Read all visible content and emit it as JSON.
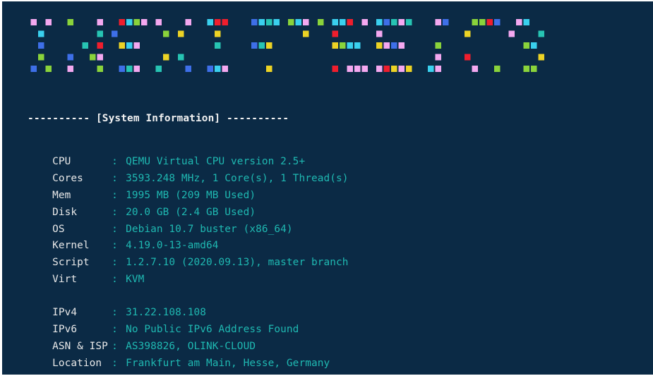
{
  "theme": {
    "background": "#0b2a45",
    "text": "#e8e8e8",
    "value_color": "#1fb9b2",
    "logo_colors": [
      "#3ad0ee",
      "#8ad33b",
      "#ef1e2d",
      "#f4a8f0",
      "#3e6fe8",
      "#ecd325",
      "#27c4b3"
    ]
  },
  "logo": {
    "text": "INSXISTEEIC8",
    "icon": "ascii-art-logo-icon"
  },
  "section_header": "---------- [System Information] ----------",
  "separator": ":",
  "info": [
    {
      "label": "CPU",
      "value": "QEMU Virtual CPU version 2.5+"
    },
    {
      "label": "Cores",
      "value": "3593.248 MHz, 1 Core(s), 1 Thread(s)"
    },
    {
      "label": "Mem",
      "value": "1995 MB (209 MB Used)"
    },
    {
      "label": "Disk",
      "value": "20.0 GB (2.4 GB Used)"
    },
    {
      "label": "OS",
      "value": "Debian 10.7 buster (x86_64)"
    },
    {
      "label": "Kernel",
      "value": "4.19.0-13-amd64"
    },
    {
      "label": "Script",
      "value": "1.2.7.10 (2020.09.13), master branch"
    },
    {
      "label": "Virt",
      "value": "KVM"
    }
  ],
  "network": [
    {
      "label": "IPv4",
      "value": "31.22.108.108"
    },
    {
      "label": "IPv6",
      "value": "No Public IPv6 Address Found"
    },
    {
      "label": "ASN & ISP",
      "value": "AS398826, OLINK-CLOUD"
    },
    {
      "label": "Location",
      "value": "Frankfurt am Main, Hesse, Germany"
    }
  ]
}
